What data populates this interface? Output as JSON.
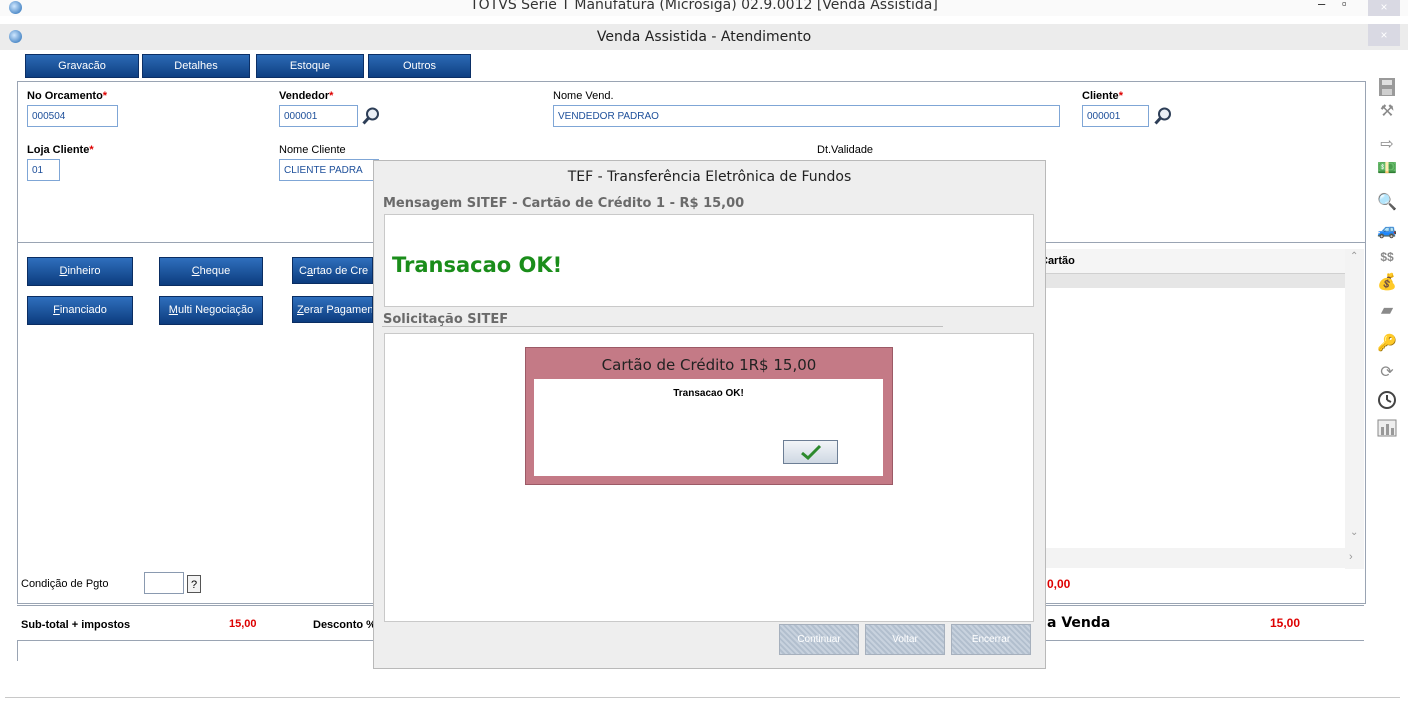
{
  "window": {
    "outer_title": "TOTVS Série T Manufatura (Microsiga) 02.9.0012 [Venda Assistida]",
    "inner_title": "Venda Assistida - Atendimento",
    "minimize_glyph": "–",
    "restore_glyph": "▫",
    "close_glyph": "×"
  },
  "tabs": [
    "Gravacão",
    "Detalhes",
    "Estoque",
    "Outros"
  ],
  "form": {
    "orcamento_label": "No Orcamento",
    "orcamento_value": "000504",
    "vendedor_label": "Vendedor",
    "vendedor_value": "000001",
    "nome_vend_label": "Nome Vend.",
    "nome_vend_value": "VENDEDOR PADRAO",
    "cliente_label": "Cliente",
    "cliente_value": "000001",
    "loja_label": "Loja Cliente",
    "loja_value": "01",
    "nome_cliente_label": "Nome Cliente",
    "nome_cliente_value": "CLIENTE PADRA",
    "dt_validade_label": "Dt.Validade",
    "required_mark": "*"
  },
  "payment_buttons": {
    "dinheiro": {
      "hot": "D",
      "rest": "inheiro"
    },
    "cheque": {
      "hot": "C",
      "rest": "heque"
    },
    "cartao": {
      "pre": "C",
      "hot": "a",
      "rest": "rtao de Cre"
    },
    "financiado": {
      "hot": "F",
      "rest": "inanciado"
    },
    "multi": {
      "hot": "M",
      "rest": "ulti Negociação"
    },
    "zerar": {
      "hot": "Z",
      "rest": "erar Pagamen"
    }
  },
  "grid": {
    "column_header": "Cartão"
  },
  "bottom": {
    "cond_pgto_label": "Condição de Pgto",
    "cond_pgto_btn": "?",
    "subtotal_label": "Sub-total + impostos",
    "subtotal_value": "15,00",
    "desconto_label": "Desconto %",
    "right_value_top": "0,00",
    "total_label": "a Venda",
    "total_value": "15,00"
  },
  "tef_dialog": {
    "title": "TEF - Transferência Eletrônica de Fundos",
    "mensagem_label": "Mensagem SITEF - Cartão de Crédito 1 - R$ 15,00",
    "message": "Transacao OK!",
    "solicitacao_label": "Solicitação SITEF",
    "buttons": [
      "Continuar",
      "Voltar",
      "Encerrar"
    ]
  },
  "popup": {
    "title": "Cartão de Crédito 1R$ 15,00",
    "message": "Transacao OK!",
    "ok_icon": "checkmark-icon"
  },
  "toolbar_icons": [
    "save-icon",
    "tools-icon",
    "exit-icon",
    "money-icon",
    "search-doc-icon",
    "car-icon",
    "currency-icon",
    "money-bag-icon",
    "eraser-icon",
    "key-icon",
    "refresh-icon",
    "clock-icon",
    "chart-icon"
  ],
  "colors": {
    "tab_blue": "#0e3f82",
    "success_green": "#1a8d1a",
    "popup_rose": "#c47a86",
    "required_red": "#dd0000"
  }
}
